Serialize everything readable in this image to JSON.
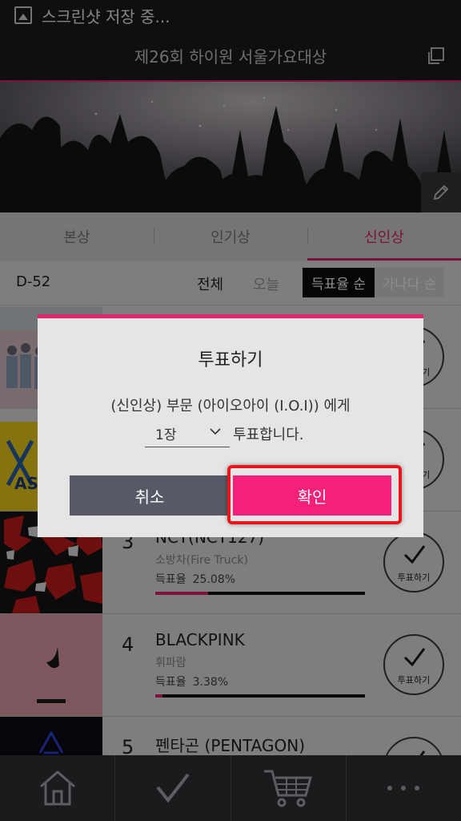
{
  "status_bar": {
    "text": "스크린샷 저장 중..."
  },
  "header": {
    "title": "제26회 하이원 서울가요대상"
  },
  "tabs": [
    {
      "label": "본상",
      "active": false
    },
    {
      "label": "인기상",
      "active": false
    },
    {
      "label": "신인상",
      "active": true
    }
  ],
  "filter": {
    "dday": "D-52",
    "all": "전체",
    "today": "오늘",
    "sort_by_rate": "득표율 순",
    "sort_by_name": "가나다 순"
  },
  "list": [
    {
      "rank": "",
      "artist": "",
      "song": "",
      "rate_label": "",
      "rate": "",
      "rate_fraction": 0,
      "vote_label": "투표하기"
    },
    {
      "rank": "",
      "artist": "",
      "song": "",
      "rate_label": "",
      "rate": "",
      "rate_fraction": 0,
      "vote_label": "투표하기"
    },
    {
      "rank": "3",
      "artist": "NCT(NCT127)",
      "song": "소방차(Fire Truck)",
      "rate_label": "득표율",
      "rate": "25.08%",
      "rate_fraction": 0.2508,
      "vote_label": "투표하기"
    },
    {
      "rank": "4",
      "artist": "BLACKPINK",
      "song": "휘파람",
      "rate_label": "득표율",
      "rate": "3.38%",
      "rate_fraction": 0.0338,
      "vote_label": "투표하기"
    },
    {
      "rank": "5",
      "artist": "펜타곤 (PENTAGON)",
      "song": "",
      "rate_label": "",
      "rate": "",
      "rate_fraction": 0,
      "vote_label": ""
    }
  ],
  "dialog": {
    "title": "투표하기",
    "message": "(신인상) 부문 (아이오아이 (I.O.I)) 에게",
    "quantity": "1장",
    "suffix": "투표합니다.",
    "cancel": "취소",
    "confirm": "확인"
  },
  "colors": {
    "accent": "#e0246e",
    "confirm_button": "#f5207a",
    "cancel_button": "#575a66",
    "highlight_box": "#e8151c"
  },
  "bottom_nav": [
    {
      "icon": "home-icon"
    },
    {
      "icon": "check-icon"
    },
    {
      "icon": "cart-icon"
    },
    {
      "icon": "more-icon"
    }
  ]
}
